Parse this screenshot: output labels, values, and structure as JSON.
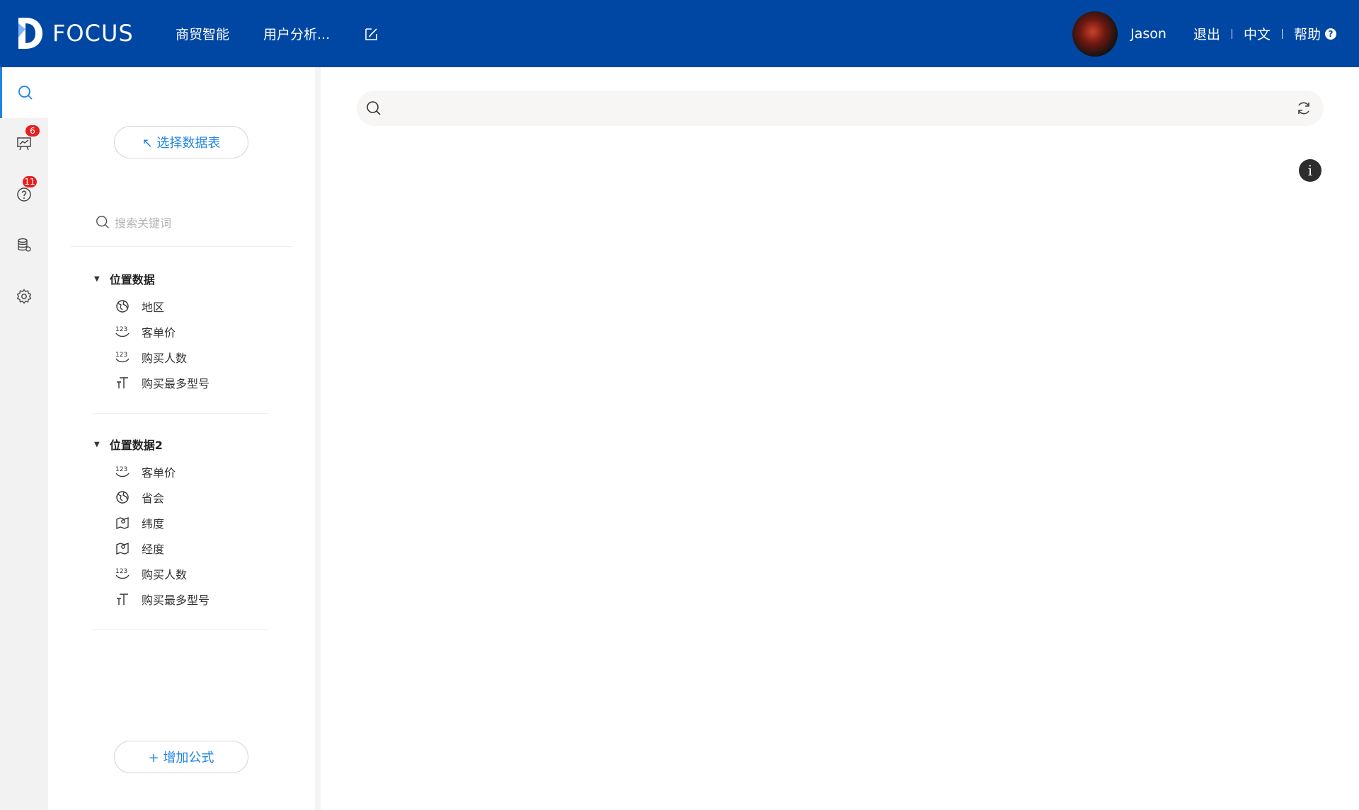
{
  "header": {
    "logo_text": "FOCUS",
    "nav": [
      {
        "label": "商贸智能"
      },
      {
        "label": "用户分析..."
      }
    ],
    "user_name": "Jason",
    "logout": "退出",
    "language": "中文",
    "help": "帮助"
  },
  "leftbar": {
    "items": [
      {
        "icon": "search-icon"
      },
      {
        "icon": "dashboard-icon",
        "badge": "6"
      },
      {
        "icon": "question-icon",
        "badge": "11"
      },
      {
        "icon": "database-icon"
      },
      {
        "icon": "gear-icon"
      }
    ]
  },
  "panel": {
    "select_table": "↖ 选择数据表",
    "search_placeholder": "搜索关键词",
    "add_formula": "+ 增加公式",
    "groups": [
      {
        "title": "位置数据",
        "fields": [
          {
            "label": "地区",
            "type": "geo"
          },
          {
            "label": "客单价",
            "type": "number"
          },
          {
            "label": "购买人数",
            "type": "number"
          },
          {
            "label": "购买最多型号",
            "type": "text"
          }
        ]
      },
      {
        "title": "位置数据2",
        "fields": [
          {
            "label": "客单价",
            "type": "number"
          },
          {
            "label": "省会",
            "type": "geo"
          },
          {
            "label": "纬度",
            "type": "map"
          },
          {
            "label": "经度",
            "type": "map"
          },
          {
            "label": "购买人数",
            "type": "number"
          },
          {
            "label": "购买最多型号",
            "type": "text"
          }
        ]
      }
    ]
  },
  "main": {
    "info_glyph": "i"
  }
}
